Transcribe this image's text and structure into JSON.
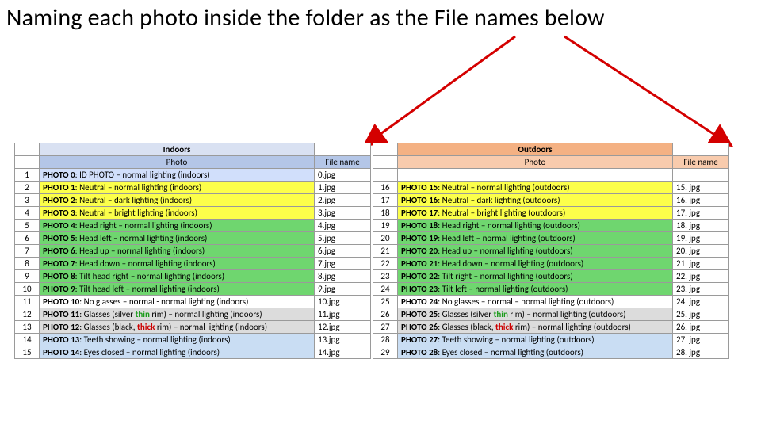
{
  "title": {
    "main": "Naming each photo inside the folder as the ",
    "fn": "File names",
    "after": " below"
  },
  "sections": {
    "indoors": "Indoors",
    "outdoors": "Outdoors"
  },
  "headers": {
    "photo": "Photo",
    "file": "File name"
  },
  "chart_data": {
    "type": "table",
    "indoors": [
      {
        "n": 1,
        "label": "PHOTO 0",
        "desc": "ID PHOTO – normal lighting (indoors)",
        "file": "0.jpg",
        "color": "blue"
      },
      {
        "n": 2,
        "label": "PHOTO 1",
        "desc": "Neutral – normal lighting (indoors)",
        "file": "1.jpg",
        "color": "yellow"
      },
      {
        "n": 3,
        "label": "PHOTO 2",
        "desc": "Neutral – dark lighting (indoors)",
        "file": "2.jpg",
        "color": "yellow"
      },
      {
        "n": 4,
        "label": "PHOTO 3",
        "desc": "Neutral – bright lighting (indoors)",
        "file": "3.jpg",
        "color": "yellow"
      },
      {
        "n": 5,
        "label": "PHOTO 4",
        "desc": "Head right – normal lighting (indoors)",
        "file": "4.jpg",
        "color": "green"
      },
      {
        "n": 6,
        "label": "PHOTO 5",
        "desc": "Head left – normal lighting (indoors)",
        "file": "5.jpg",
        "color": "green"
      },
      {
        "n": 7,
        "label": "PHOTO 6",
        "desc": "Head up – normal lighting (indoors)",
        "file": "6.jpg",
        "color": "green"
      },
      {
        "n": 8,
        "label": "PHOTO 7",
        "desc": "Head down – normal lighting (indoors)",
        "file": "7.jpg",
        "color": "green"
      },
      {
        "n": 9,
        "label": "PHOTO 8",
        "desc": "Tilt head right – normal lighting (indoors)",
        "file": "8.jpg",
        "color": "green"
      },
      {
        "n": 10,
        "label": "PHOTO 9",
        "desc": "Tilt head left – normal lighting (indoors)",
        "file": "9.jpg",
        "color": "green"
      },
      {
        "n": 11,
        "label": "PHOTO 10",
        "desc": "No glasses – normal - normal lighting (indoors)",
        "file": "10.jpg",
        "color": "white"
      },
      {
        "n": 12,
        "label": "PHOTO 11",
        "desc": "Glasses (silver |thin| rim) – normal lighting (indoors)",
        "file": "11.jpg",
        "color": "grey"
      },
      {
        "n": 13,
        "label": "PHOTO 12",
        "desc": "Glasses (black, |thick| rim) – normal lighting (indoors)",
        "file": "12.jpg",
        "color": "grey"
      },
      {
        "n": 14,
        "label": "PHOTO 13",
        "desc": "Teeth showing – normal lighting (indoors)",
        "file": "13.jpg",
        "color": "lblue"
      },
      {
        "n": 15,
        "label": "PHOTO 14",
        "desc": "Eyes closed – normal lighting (indoors)",
        "file": "14.jpg",
        "color": "lblue"
      }
    ],
    "outdoors": [
      {
        "n": 16,
        "label": "PHOTO 15",
        "desc": "Neutral – normal lighting (outdoors)",
        "file": "15. jpg",
        "color": "yellow"
      },
      {
        "n": 17,
        "label": "PHOTO 16",
        "desc": "Neutral – dark lighting (outdoors)",
        "file": "16. jpg",
        "color": "yellow"
      },
      {
        "n": 18,
        "label": "PHOTO 17",
        "desc": "Neutral – bright  lighting  (outdoors)",
        "file": "17. jpg",
        "color": "yellow"
      },
      {
        "n": 19,
        "label": "PHOTO 18",
        "desc": "Head right – normal lighting (outdoors)",
        "file": "18. jpg",
        "color": "green"
      },
      {
        "n": 20,
        "label": "PHOTO 19",
        "desc": "Head left – normal lighting (outdoors)",
        "file": "19. jpg",
        "color": "green"
      },
      {
        "n": 21,
        "label": "PHOTO 20",
        "desc": "Head up – normal lighting (outdoors)",
        "file": "20. jpg",
        "color": "green"
      },
      {
        "n": 22,
        "label": "PHOTO 21",
        "desc": "Head down – normal lighting (outdoors)",
        "file": "21. jpg",
        "color": "green"
      },
      {
        "n": 23,
        "label": "PHOTO 22",
        "desc": "Tilt right – normal lighting (outdoors)",
        "file": "22. jpg",
        "color": "green"
      },
      {
        "n": 24,
        "label": "PHOTO 23",
        "desc": "Tilt left – normal lighting (outdoors)",
        "file": "23. jpg",
        "color": "green"
      },
      {
        "n": 25,
        "label": "PHOTO 24",
        "desc": "No glasses – normal – normal lighting (outdoors)",
        "file": "24. jpg",
        "color": "white"
      },
      {
        "n": 26,
        "label": "PHOTO 25",
        "desc": "Glasses (silver |thin| rim) – normal lighting (outdoors)",
        "file": "25. jpg",
        "color": "grey"
      },
      {
        "n": 27,
        "label": "PHOTO 26",
        "desc": "Glasses (black, |thick| rim) – normal lighting (outdoors)",
        "file": "26. jpg",
        "color": "grey"
      },
      {
        "n": 28,
        "label": "PHOTO 27",
        "desc": "Teeth showing – normal lighting (outdoors)",
        "file": "27. jpg",
        "color": "lblue"
      },
      {
        "n": 29,
        "label": "PHOTO 28",
        "desc": "Eyes closed – normal lighting (outdoors)",
        "file": "28. jpg",
        "color": "lblue"
      }
    ]
  }
}
